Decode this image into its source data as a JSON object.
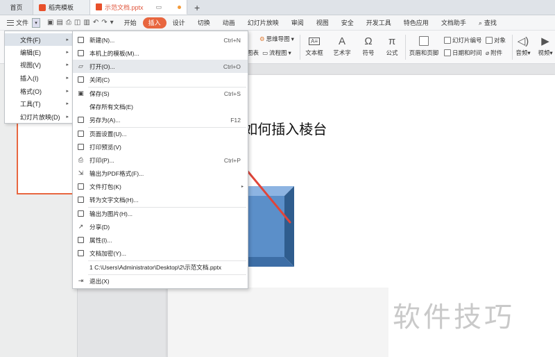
{
  "tabs": {
    "home": "首页",
    "templates": "稻壳模板",
    "document": "示范文档.pptx",
    "add": "+"
  },
  "menubar": {
    "file_label": "文件",
    "ribbon_tabs": [
      "开始",
      "插入",
      "设计",
      "切换",
      "动画",
      "幻灯片放映",
      "审阅",
      "视图",
      "安全",
      "开发工具",
      "特色应用",
      "文档助手"
    ],
    "active_tab": "插入",
    "search_label": "查找"
  },
  "ribbon": {
    "mindmap": "思维导图",
    "chart": "图表",
    "flowchart": "流程图",
    "textbox": "文本框",
    "wordart": "艺术字",
    "symbol": "符号",
    "formula": "公式",
    "header_footer": "页眉和页脚",
    "slide_number": "幻灯片编号",
    "date_time": "日期和时间",
    "object": "对象",
    "attachment": "附件",
    "audio": "音频",
    "video": "视频"
  },
  "main_menu": {
    "items": [
      {
        "label": "文件(F)"
      },
      {
        "label": "编辑(E)"
      },
      {
        "label": "视图(V)"
      },
      {
        "label": "插入(I)"
      },
      {
        "label": "格式(O)"
      },
      {
        "label": "工具(T)"
      },
      {
        "label": "幻灯片放映(D)"
      }
    ]
  },
  "file_menu": {
    "items": [
      {
        "label": "新建(N)...",
        "shortcut": "Ctrl+N"
      },
      {
        "label": "本机上的模板(M)...",
        "shortcut": ""
      },
      {
        "label": "打开(O)...",
        "shortcut": "Ctrl+O"
      },
      {
        "label": "关闭(C)",
        "shortcut": ""
      },
      {
        "label": "保存(S)",
        "shortcut": "Ctrl+S"
      },
      {
        "label": "保存所有文档(E)",
        "shortcut": ""
      },
      {
        "label": "另存为(A)...",
        "shortcut": "F12"
      },
      {
        "label": "页面设置(U)...",
        "shortcut": ""
      },
      {
        "label": "打印预览(V)",
        "shortcut": ""
      },
      {
        "label": "打印(P)...",
        "shortcut": "Ctrl+P"
      },
      {
        "label": "输出为PDF格式(F)...",
        "shortcut": ""
      },
      {
        "label": "文件打包(K)",
        "shortcut": ""
      },
      {
        "label": "转为文字文档(H)...",
        "shortcut": ""
      },
      {
        "label": "输出为图片(H)...",
        "shortcut": ""
      },
      {
        "label": "分享(D)",
        "shortcut": ""
      },
      {
        "label": "属性(I)...",
        "shortcut": ""
      },
      {
        "label": "文档加密(Y)...",
        "shortcut": ""
      },
      {
        "label": "1 C:\\Users\\Administrator\\Desktop\\2\\示范文档.pptx",
        "shortcut": ""
      },
      {
        "label": "退出(X)",
        "shortcut": ""
      }
    ]
  },
  "slide": {
    "title": "ppt如何插入棱台"
  },
  "watermark": "软件技巧",
  "colors": {
    "accent": "#e8663f",
    "bevel_face": "#5b8fc9",
    "arrow": "#e0453a"
  }
}
